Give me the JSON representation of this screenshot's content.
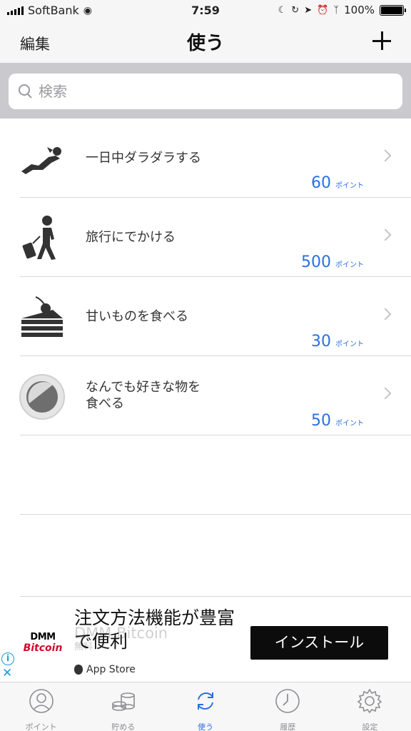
{
  "status_bar": {
    "carrier": "SoftBank",
    "time": "7:59",
    "battery": "100%"
  },
  "nav": {
    "edit_label": "編集",
    "title": "使う",
    "add_icon": "plus-icon"
  },
  "search": {
    "placeholder": "検索"
  },
  "items": [
    {
      "label": "一日中ダラダラする",
      "points": "60",
      "unit": "ポイント",
      "icon": "lounging-person-icon"
    },
    {
      "label": "旅行にでかける",
      "points": "500",
      "unit": "ポイント",
      "icon": "traveler-icon"
    },
    {
      "label": "甘いものを食べる",
      "points": "30",
      "unit": "ポイント",
      "icon": "cake-icon"
    },
    {
      "label": "なんでも好きな物を\n食べる",
      "points": "50",
      "unit": "ポイント",
      "icon": "plate-icon"
    }
  ],
  "ad": {
    "logo_top": "DMM",
    "logo_bottom": "Bitcoin",
    "headline": "注文方法機能が豊富で便利",
    "subtitle": "DMM Bitcoin",
    "subtitle_small": "無料",
    "store": "App Store",
    "install_label": "インストール"
  },
  "tabs": [
    {
      "label": "ポイント",
      "icon": "person-icon",
      "active": false
    },
    {
      "label": "貯める",
      "icon": "coins-icon",
      "active": false
    },
    {
      "label": "使う",
      "icon": "refresh-icon",
      "active": true
    },
    {
      "label": "履歴",
      "icon": "clock-icon",
      "active": false
    },
    {
      "label": "設定",
      "icon": "gear-icon",
      "active": false
    }
  ],
  "colors": {
    "accent": "#2a70e0",
    "install_bg": "#0c0c0c"
  }
}
